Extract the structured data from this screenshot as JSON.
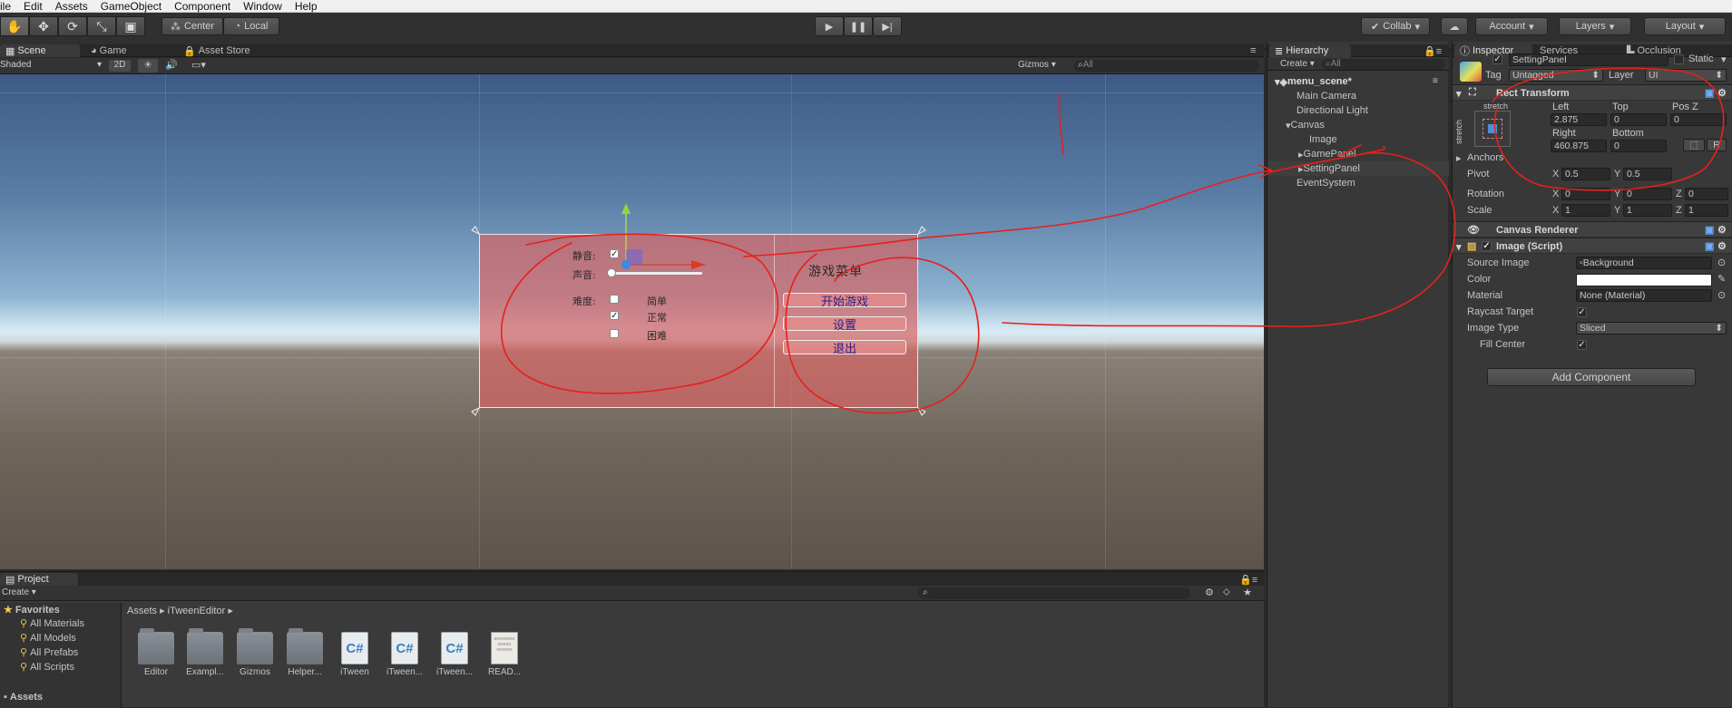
{
  "menu": [
    "ile",
    "Edit",
    "Assets",
    "GameObject",
    "Component",
    "Window",
    "Help"
  ],
  "toolbar": {
    "tools": [
      "hand-icon",
      "move-icon",
      "rotate-icon",
      "scale-icon",
      "rect-icon"
    ],
    "pivot": "Center",
    "space": "Local",
    "collab": "Collab",
    "account": "Account",
    "layers": "Layers",
    "layout": "Layout"
  },
  "tabs": {
    "scene": "Scene",
    "game": "Game",
    "store": "Asset Store"
  },
  "scene_bar": {
    "shading": "Shaded",
    "mode2d": "2D",
    "gizmos": "Gizmos",
    "search_placeholder": "All"
  },
  "panel_ui": {
    "mute": "静音:",
    "volume": "声音:",
    "difficulty": "难度:",
    "easy": "简单",
    "normal": "正常",
    "hard": "困难",
    "menu_title": "游戏菜单",
    "start": "开始游戏",
    "settings": "设置",
    "quit": "退出"
  },
  "hierarchy": {
    "tab": "Hierarchy",
    "create": "Create",
    "search_placeholder": "All",
    "scene_name": "menu_scene*",
    "items": [
      "Main Camera",
      "Directional Light",
      "Canvas",
      "Image",
      "GamePanel",
      "SettingPanel",
      "EventSystem"
    ]
  },
  "inspector": {
    "tabs": [
      "Inspector",
      "Services",
      "Occlusion"
    ],
    "object_name": "SettingPanel",
    "static": "Static",
    "tag_label": "Tag",
    "tag_value": "Untagged",
    "layer_label": "Layer",
    "layer_value": "UI",
    "rect_title": "Rect Transform",
    "stretch_h": "stretch",
    "stretch_v": "stretch",
    "left_label": "Left",
    "top_label": "Top",
    "posz_label": "Pos Z",
    "left": "2.875",
    "top": "0",
    "posz": "0",
    "right_label": "Right",
    "bottom_label": "Bottom",
    "right": "460.875",
    "bottom": "0",
    "r_btn": "R",
    "anchors": "Anchors",
    "pivot_label": "Pivot",
    "pivot_x": "0.5",
    "pivot_y": "0.5",
    "rotation_label": "Rotation",
    "rot_x": "0",
    "rot_y": "0",
    "rot_z": "0",
    "scale_label": "Scale",
    "scale_x": "1",
    "scale_y": "1",
    "scale_z": "1",
    "canvas_renderer": "Canvas Renderer",
    "image_script": "Image (Script)",
    "source_image_label": "Source Image",
    "source_image": "Background",
    "color_label": "Color",
    "material_label": "Material",
    "material": "None (Material)",
    "raycast_label": "Raycast Target",
    "image_type_label": "Image Type",
    "image_type": "Sliced",
    "fill_center_label": "Fill Center",
    "add_component": "Add Component"
  },
  "project": {
    "tab": "Project",
    "create": "Create",
    "favorites": "Favorites",
    "fav_items": [
      "All Materials",
      "All Models",
      "All Prefabs",
      "All Scripts"
    ],
    "assets_root": "Assets",
    "breadcrumb_root": "Assets",
    "breadcrumb_folder": "iTweenEditor",
    "assets": [
      {
        "name": "Editor",
        "kind": "folder"
      },
      {
        "name": "Exampl...",
        "kind": "folder"
      },
      {
        "name": "Gizmos",
        "kind": "folder"
      },
      {
        "name": "Helper...",
        "kind": "folder"
      },
      {
        "name": "iTween",
        "kind": "script"
      },
      {
        "name": "iTween...",
        "kind": "script"
      },
      {
        "name": "iTween...",
        "kind": "script"
      },
      {
        "name": "READ...",
        "kind": "doc"
      }
    ]
  },
  "colors": {
    "annotation": "#e8201c",
    "panel": "#d66464",
    "button_text": "#2a1d8a"
  }
}
